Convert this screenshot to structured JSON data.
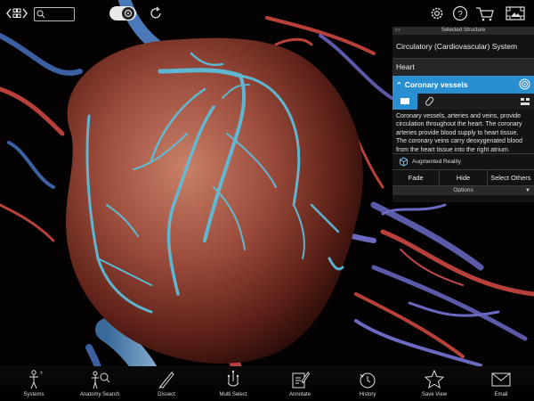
{
  "topbar": {
    "search": {
      "placeholder": "",
      "value": ""
    },
    "icons": [
      "grid-back-icon",
      "search-icon",
      "view-toggle-icon",
      "reset-rotate-icon",
      "settings-icon",
      "help-icon",
      "cart-icon",
      "screenshot-icon"
    ]
  },
  "panel": {
    "header_label": "Selected Structure",
    "system": "Circulatory (Cardiovascular) System",
    "organ": "Heart",
    "selected_structure": "Coronary vessels",
    "description": "Coronary vessels, arteries and veins, provide circulation throughout the heart. The coronary arteries provide blood supply to heart tissue. The coronary veins carry deoxygenated blood from the heart tissue into the right atrium.",
    "augmented_reality": "Augmented Reality",
    "actions": [
      "Fade",
      "Hide",
      "Select Others"
    ],
    "options_label": "Options"
  },
  "bottombar": {
    "items": [
      {
        "label": "Systems",
        "icon": "systems-icon"
      },
      {
        "label": "Anatomy Search",
        "icon": "anatomy-search-icon"
      },
      {
        "label": "Dissect",
        "icon": "dissect-icon"
      },
      {
        "label": "Multi Select",
        "icon": "multi-select-icon"
      },
      {
        "label": "Annotate",
        "icon": "annotate-icon"
      },
      {
        "label": "History",
        "icon": "history-icon"
      },
      {
        "label": "Save View",
        "icon": "save-view-icon"
      },
      {
        "label": "Email",
        "icon": "email-icon"
      }
    ]
  },
  "colors": {
    "accent": "#2a8fd0",
    "heart": "#9a4a3a",
    "vessels": "#5bc0de"
  }
}
